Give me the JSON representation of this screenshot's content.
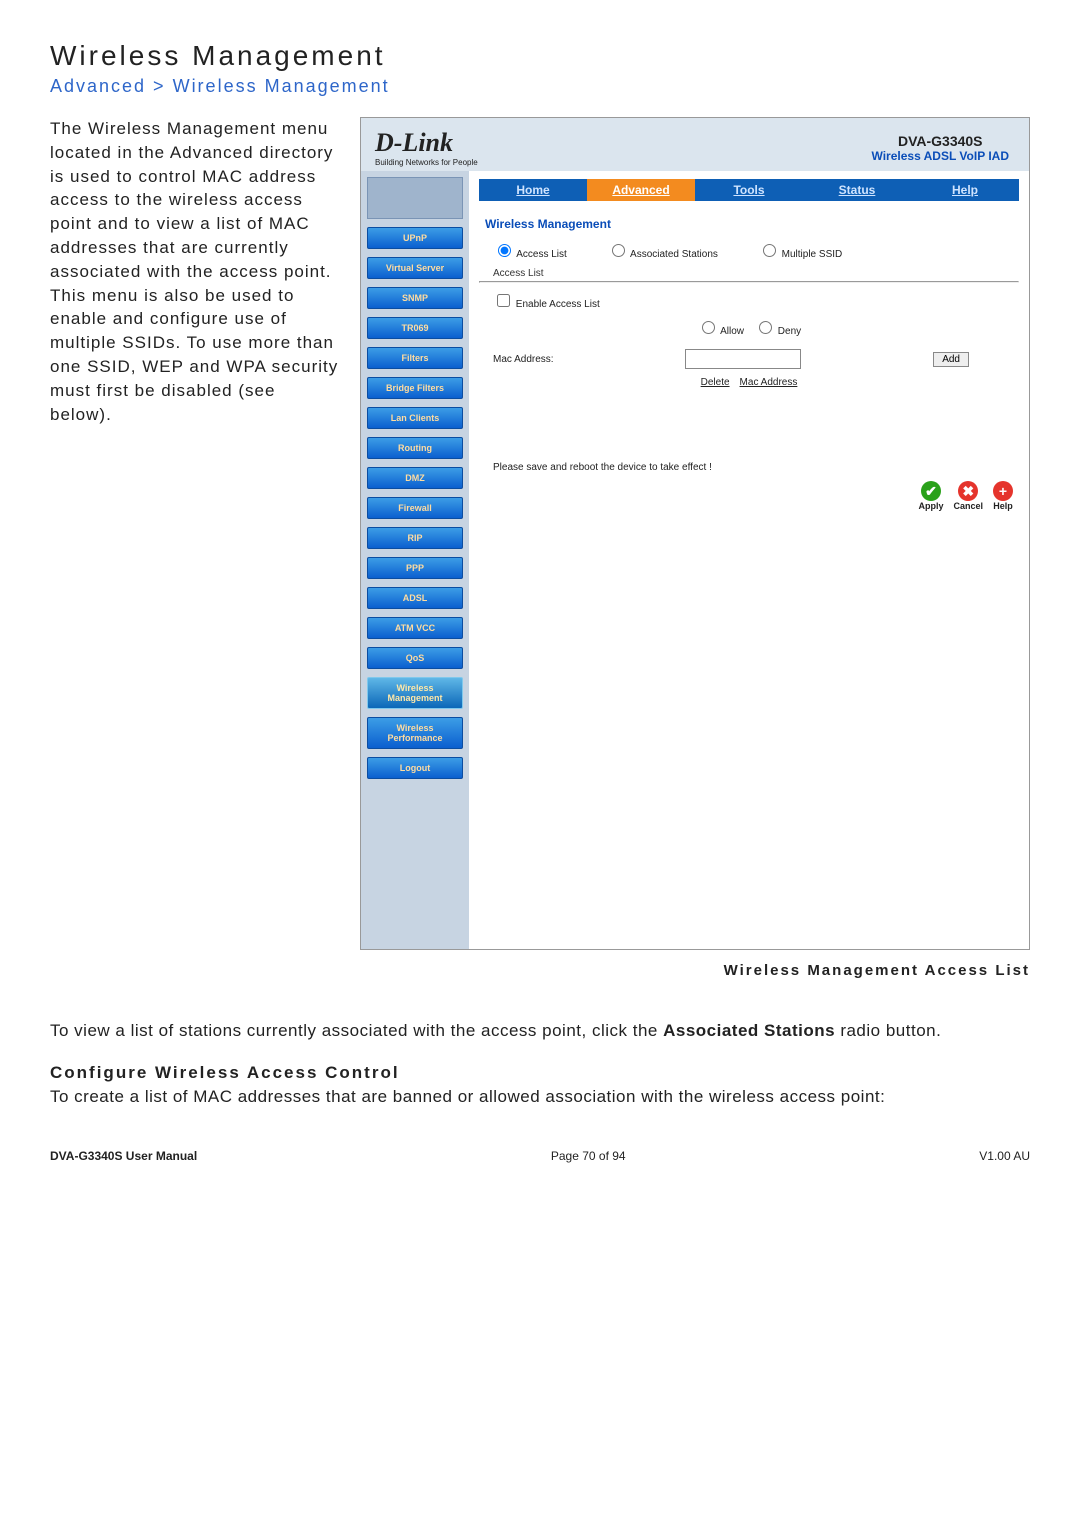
{
  "page": {
    "title": "Wireless Management",
    "breadcrumb": "Advanced > Wireless Management",
    "intro_html": "The Wireless Management menu located in the Advanced directory is used to control MAC address access to the wireless access point and to view a list of MAC addresses that are currently associated with the access point. This menu is also be used to enable and configure use of multiple SSIDs. To use more than one SSID, WEP and WPA security must first be disabled (see below).",
    "caption": "Wireless Management Access List",
    "para2_pre": "To view a list of stations currently associated with the access point, click the ",
    "para2_bold": "Associated Stations",
    "para2_post": " radio button.",
    "subhead": "Configure Wireless Access Control",
    "para3": "To create a list of MAC addresses that are banned or allowed association with the wireless access point:"
  },
  "screenshot": {
    "brand": "D-Link",
    "brand_sub": "Building Networks for People",
    "model": "DVA-G3340S",
    "model_sub": "Wireless ADSL VoIP IAD",
    "tabs": [
      "Home",
      "Advanced",
      "Tools",
      "Status",
      "Help"
    ],
    "active_tab": "Advanced",
    "sidebar": [
      "UPnP",
      "Virtual Server",
      "SNMP",
      "TR069",
      "Filters",
      "Bridge Filters",
      "Lan Clients",
      "Routing",
      "DMZ",
      "Firewall",
      "RIP",
      "PPP",
      "ADSL",
      "ATM VCC",
      "QoS",
      "Wireless Management",
      "Wireless Performance",
      "Logout"
    ],
    "active_sidebar": "Wireless Management",
    "panel_title": "Wireless Management",
    "radios": [
      "Access List",
      "Associated Stations",
      "Multiple SSID"
    ],
    "selected_radio": "Access List",
    "sub_title": "Access List",
    "enable_label": "Enable Access List",
    "allow": "Allow",
    "deny": "Deny",
    "mac_label": "Mac Address:",
    "add": "Add",
    "delete": "Delete",
    "mac_col": "Mac Address",
    "note": "Please save and reboot the device to take effect !",
    "actions": {
      "apply": "Apply",
      "cancel": "Cancel",
      "help": "Help"
    }
  },
  "footer": {
    "left": "DVA-G3340S User Manual",
    "center": "Page 70 of 94",
    "right": "V1.00 AU"
  }
}
